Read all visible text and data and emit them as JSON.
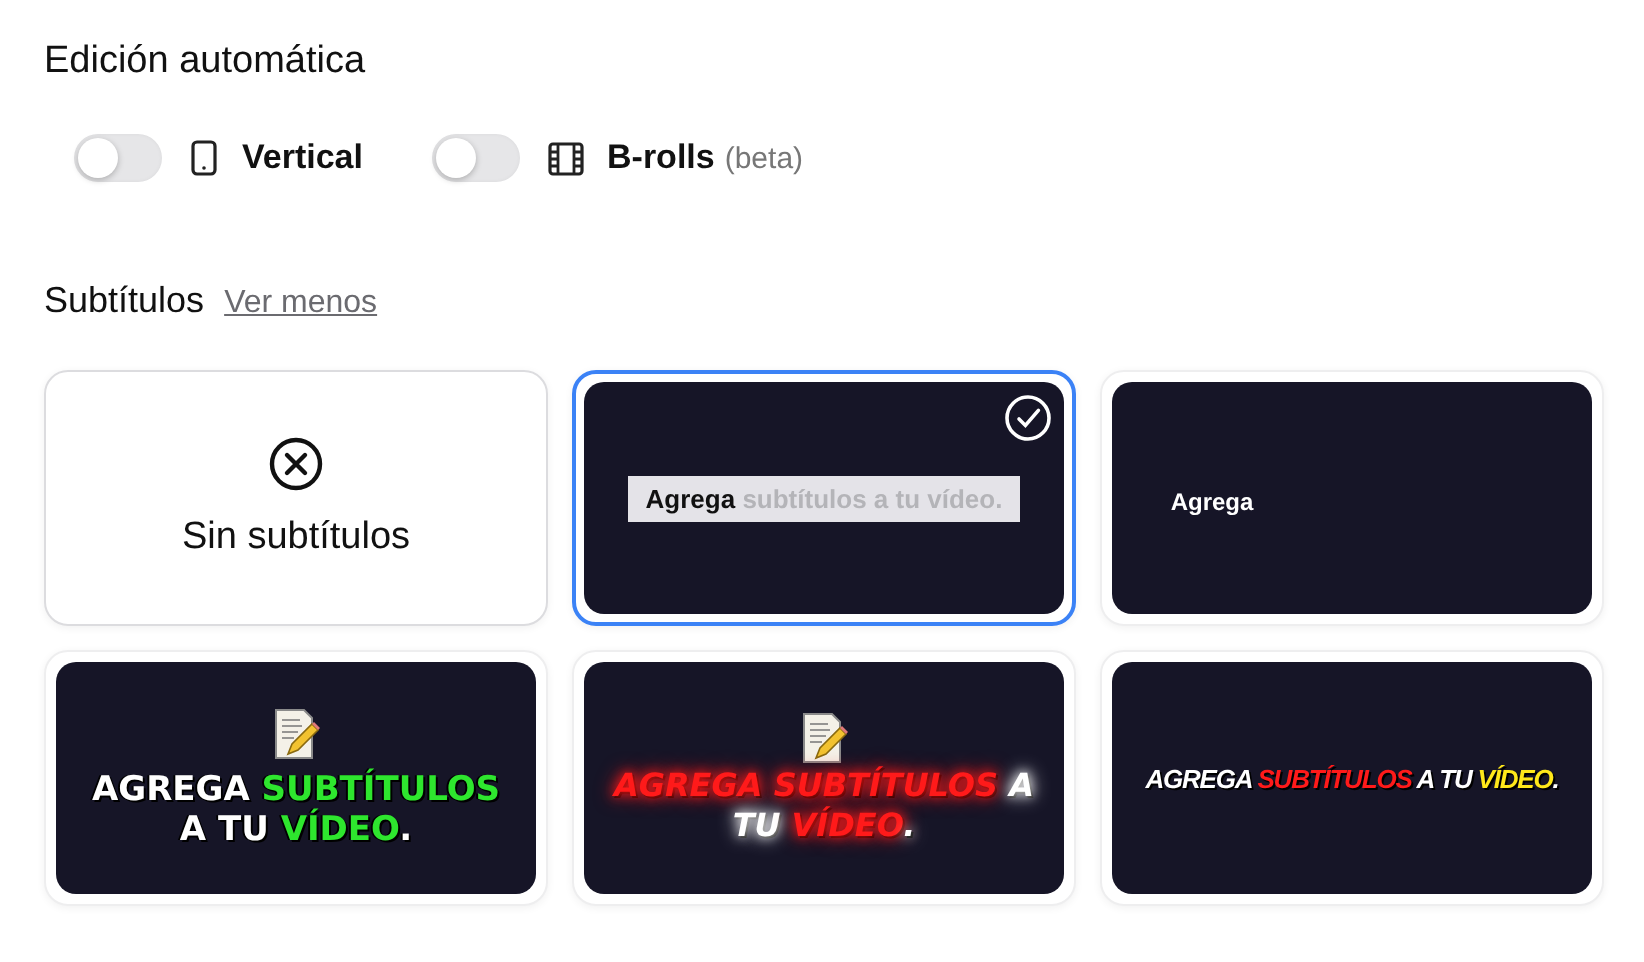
{
  "title": "Edición automática",
  "toggles": [
    {
      "kind": "phone",
      "label": "Vertical",
      "on": false
    },
    {
      "kind": "film",
      "label": "B-rolls",
      "note": "(beta)",
      "on": false
    }
  ],
  "subtitles": {
    "heading": "Subtítulos",
    "link": "Ver menos",
    "options": [
      {
        "kind": "none",
        "label": "Sin subtítulos",
        "selected": false
      },
      {
        "kind": "box",
        "selected": true,
        "segments": [
          {
            "text": "Agrega",
            "color": "#111111"
          },
          {
            "text": " subtítulos a tu vídeo.",
            "color": "#b4b4b8"
          }
        ]
      },
      {
        "kind": "word",
        "selected": false,
        "segments": [
          {
            "text": "Agrega",
            "color": "#ffffff"
          }
        ]
      },
      {
        "kind": "bold",
        "selected": false,
        "segments": [
          {
            "text": "AGREGA ",
            "color": "#ffffff"
          },
          {
            "text": "SUBTÍTULOS",
            "color": "#2ee62e"
          },
          {
            "text": " A TU ",
            "color": "#ffffff"
          },
          {
            "text": "VÍDEO",
            "color": "#2ee62e"
          },
          {
            "text": ".",
            "color": "#ffffff"
          }
        ]
      },
      {
        "kind": "glow",
        "selected": false,
        "segments": [
          {
            "text": "AGREGA SUBTÍTULOS",
            "color": "#ff1a1a"
          },
          {
            "text": " A TU ",
            "color": "#ffffff"
          },
          {
            "text": "VÍDEO",
            "color": "#ff1a1a"
          },
          {
            "text": ".",
            "color": "#ffffff"
          }
        ]
      },
      {
        "kind": "condensed",
        "selected": false,
        "segments": [
          {
            "text": "AGREGA ",
            "color": "#ffffff"
          },
          {
            "text": "SUBTÍTULOS",
            "color": "#ff1a1a"
          },
          {
            "text": " A TU ",
            "color": "#ffffff"
          },
          {
            "text": "VÍDEO",
            "color": "#ffe81a"
          },
          {
            "text": ".",
            "color": "#ffffff"
          }
        ]
      }
    ]
  }
}
